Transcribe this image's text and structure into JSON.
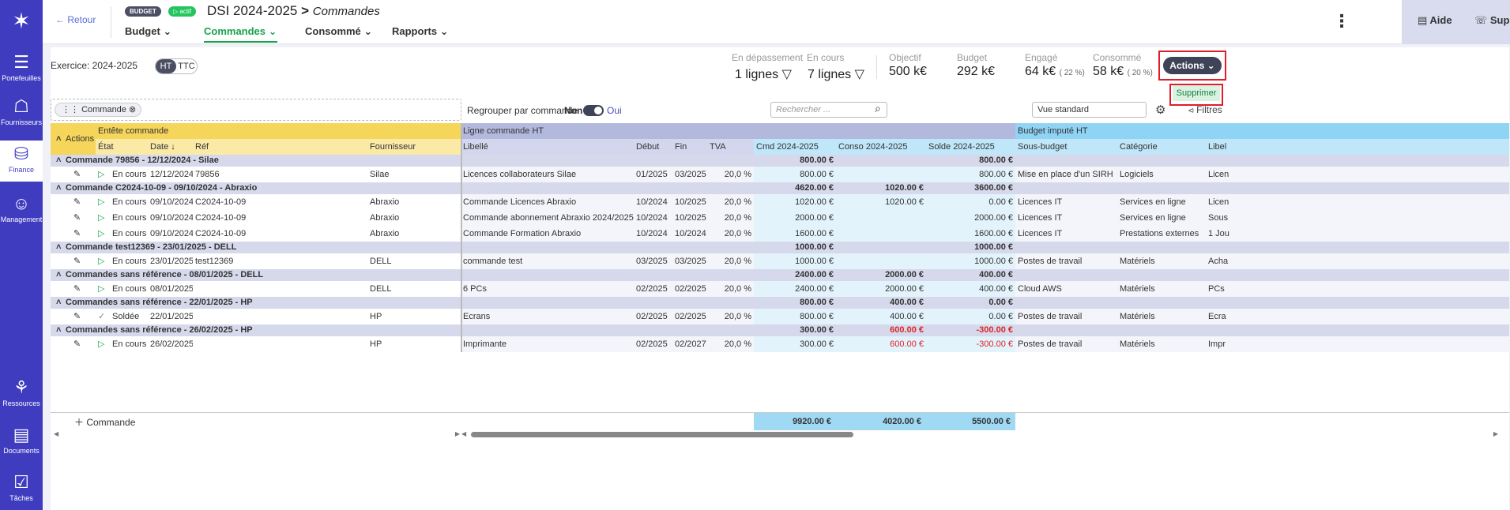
{
  "sidebar": {
    "logo": "✶",
    "items": [
      {
        "label": "Portefeuilles",
        "icon": "portfolio-icon",
        "glyph": "☰"
      },
      {
        "label": "Fournisseurs",
        "icon": "supplier-icon",
        "glyph": "☖"
      },
      {
        "label": "Finance",
        "icon": "finance-icon",
        "glyph": "⛁"
      },
      {
        "label": "Management",
        "icon": "management-icon",
        "glyph": "☺"
      },
      {
        "label": "Ressources",
        "icon": "resources-icon",
        "glyph": "⚘"
      },
      {
        "label": "Documents",
        "icon": "documents-icon",
        "glyph": "▤"
      },
      {
        "label": "Tâches",
        "icon": "tasks-icon",
        "glyph": "☑"
      }
    ]
  },
  "header": {
    "back_label": "← Retour",
    "budget_badge": "BUDGET",
    "active_badge": "▷ actif",
    "title": "DSI 2024-2025",
    "title_sep": ">",
    "subtitle": "Commandes",
    "tabs": [
      {
        "label": "Budget ⌄"
      },
      {
        "label": "Commandes ⌄"
      },
      {
        "label": "Consommé ⌄"
      },
      {
        "label": "Rapports ⌄"
      }
    ],
    "kebab": "⋮",
    "help": "Aide",
    "support": "Support"
  },
  "summary": {
    "exercise": "Exercice: 2024-2025",
    "ht": "HT",
    "ttc": "TTC",
    "depassement_label": "En dépassement",
    "depassement_value": "1 lignes ▽",
    "encours_label": "En cours",
    "encours_value": "7 lignes ▽",
    "objectif_label": "Objectif",
    "objectif_value": "500 k€",
    "budget_label": "Budget",
    "budget_value": "292 k€",
    "engage_label": "Engagé",
    "engage_value": "64 k€",
    "engage_pct": "( 22 %)",
    "consomme_label": "Consommé",
    "consomme_value": "58 k€",
    "consomme_pct": "( 20 %)",
    "actions_label": "Actions ⌄",
    "supprimer_label": "Supprimer"
  },
  "toolbar": {
    "chip": "Commande",
    "chip_close": "⊗",
    "regroup": "Regrouper par commande",
    "non": "Non",
    "oui": "Oui",
    "search_placeholder": "Rechercher ...",
    "search_icon": "⌕",
    "view": "Vue standard",
    "settings": "⚙",
    "filters": "⪦ Filtres"
  },
  "colors": {
    "yellow_head": "#f5d55a",
    "yellow_sub": "#fbe9a6",
    "lav_head": "#b3b8dd",
    "lav_sub": "#d3d7ee",
    "blue_head": "#8fd3f5",
    "blue_sub": "#bfe6f9",
    "group": "#d6d9ec",
    "red": "#dc2626",
    "green": "#16a34a"
  },
  "table": {
    "groups_header": [
      "",
      "Entête commande",
      "Ligne commande HT",
      "Budget imputé HT"
    ],
    "actions_label": "Actions",
    "collapse_icon": "˄",
    "columns": [
      "État",
      "Date ↓",
      "Réf",
      "Fournisseur",
      "Libellé",
      "Début",
      "Fin",
      "TVA",
      "Cmd 2024-2025",
      "Conso 2024-2025",
      "Solde 2024-2025",
      "Sous-budget",
      "Catégorie",
      "Libel"
    ],
    "rows": [
      {
        "type": "group",
        "title": "Commande 79856 - 12/12/2024 - Silae",
        "cmd": "800.00 €",
        "conso": "",
        "solde": "800.00 €"
      },
      {
        "type": "line",
        "state": "En cours",
        "date": "12/12/2024",
        "ref": "79856",
        "supplier": "Silae",
        "label": "Licences collaborateurs Silae",
        "start": "01/2025",
        "end": "03/2025",
        "tva": "20,0 %",
        "cmd": "800.00 €",
        "conso": "",
        "solde": "800.00 €",
        "sub": "Mise en place d'un SIRH",
        "cat": "Logiciels",
        "lib": "Licen"
      },
      {
        "type": "group",
        "title": "Commande C2024-10-09 - 09/10/2024 - Abraxio",
        "cmd": "4620.00 €",
        "conso": "1020.00 €",
        "solde": "3600.00 €"
      },
      {
        "type": "line",
        "state": "En cours",
        "date": "09/10/2024",
        "ref": "C2024-10-09",
        "supplier": "Abraxio",
        "label": "Commande Licences Abraxio",
        "start": "10/2024",
        "end": "10/2025",
        "tva": "20,0 %",
        "cmd": "1020.00 €",
        "conso": "1020.00 €",
        "solde": "0.00 €",
        "sub": "Licences IT",
        "cat": "Services en ligne",
        "lib": "Licen"
      },
      {
        "type": "line",
        "state": "En cours",
        "date": "09/10/2024",
        "ref": "C2024-10-09",
        "supplier": "Abraxio",
        "label": "Commande abonnement Abraxio 2024/2025",
        "start": "10/2024",
        "end": "10/2025",
        "tva": "20,0 %",
        "cmd": "2000.00 €",
        "conso": "",
        "solde": "2000.00 €",
        "sub": "Licences IT",
        "cat": "Services en ligne",
        "lib": "Sous"
      },
      {
        "type": "line",
        "state": "En cours",
        "date": "09/10/2024",
        "ref": "C2024-10-09",
        "supplier": "Abraxio",
        "label": "Commande Formation Abraxio",
        "start": "10/2024",
        "end": "10/2024",
        "tva": "20,0 %",
        "cmd": "1600.00 €",
        "conso": "",
        "solde": "1600.00 €",
        "sub": "Licences IT",
        "cat": "Prestations externes",
        "lib": "1 Jou"
      },
      {
        "type": "group",
        "title": "Commande test12369 - 23/01/2025 - DELL",
        "cmd": "1000.00 €",
        "conso": "",
        "solde": "1000.00 €"
      },
      {
        "type": "line",
        "state": "En cours",
        "date": "23/01/2025",
        "ref": "test12369",
        "supplier": "DELL",
        "label": "commande test",
        "start": "03/2025",
        "end": "03/2025",
        "tva": "20,0 %",
        "cmd": "1000.00 €",
        "conso": "",
        "solde": "1000.00 €",
        "sub": "Postes de travail",
        "cat": "Matériels",
        "lib": "Acha"
      },
      {
        "type": "group",
        "title": "Commandes sans référence - 08/01/2025 - DELL",
        "cmd": "2400.00 €",
        "conso": "2000.00 €",
        "solde": "400.00 €"
      },
      {
        "type": "line",
        "state": "En cours",
        "date": "08/01/2025",
        "ref": "",
        "supplier": "DELL",
        "label": "6 PCs",
        "start": "02/2025",
        "end": "02/2025",
        "tva": "20,0 %",
        "cmd": "2400.00 €",
        "conso": "2000.00 €",
        "solde": "400.00 €",
        "sub": "Cloud AWS",
        "cat": "Matériels",
        "lib": "PCs"
      },
      {
        "type": "group",
        "title": "Commandes sans référence - 22/01/2025 - HP",
        "cmd": "800.00 €",
        "conso": "400.00 €",
        "solde": "0.00 €"
      },
      {
        "type": "line",
        "state": "Soldée",
        "date": "22/01/2025",
        "ref": "",
        "supplier": "HP",
        "label": "Ecrans",
        "start": "02/2025",
        "end": "02/2025",
        "tva": "20,0 %",
        "cmd": "800.00 €",
        "conso": "400.00 €",
        "solde": "0.00 €",
        "sub": "Postes de travail",
        "cat": "Matériels",
        "lib": "Ecra"
      },
      {
        "type": "group",
        "title": "Commandes sans référence - 26/02/2025 - HP",
        "cmd": "300.00 €",
        "conso": "600.00 €",
        "solde": "-300.00 €",
        "neg": true
      },
      {
        "type": "line",
        "state": "En cours",
        "date": "26/02/2025",
        "ref": "",
        "supplier": "HP",
        "label": "Imprimante",
        "start": "02/2025",
        "end": "02/2027",
        "tva": "20,0 %",
        "cmd": "300.00 €",
        "conso": "600.00 €",
        "solde": "-300.00 €",
        "sub": "Postes de travail",
        "cat": "Matériels",
        "lib": "Impr",
        "neg": true
      }
    ],
    "add_label": "＋  Commande",
    "totals": {
      "cmd": "9920.00 €",
      "conso": "4020.00 €",
      "solde": "5500.00 €"
    }
  }
}
